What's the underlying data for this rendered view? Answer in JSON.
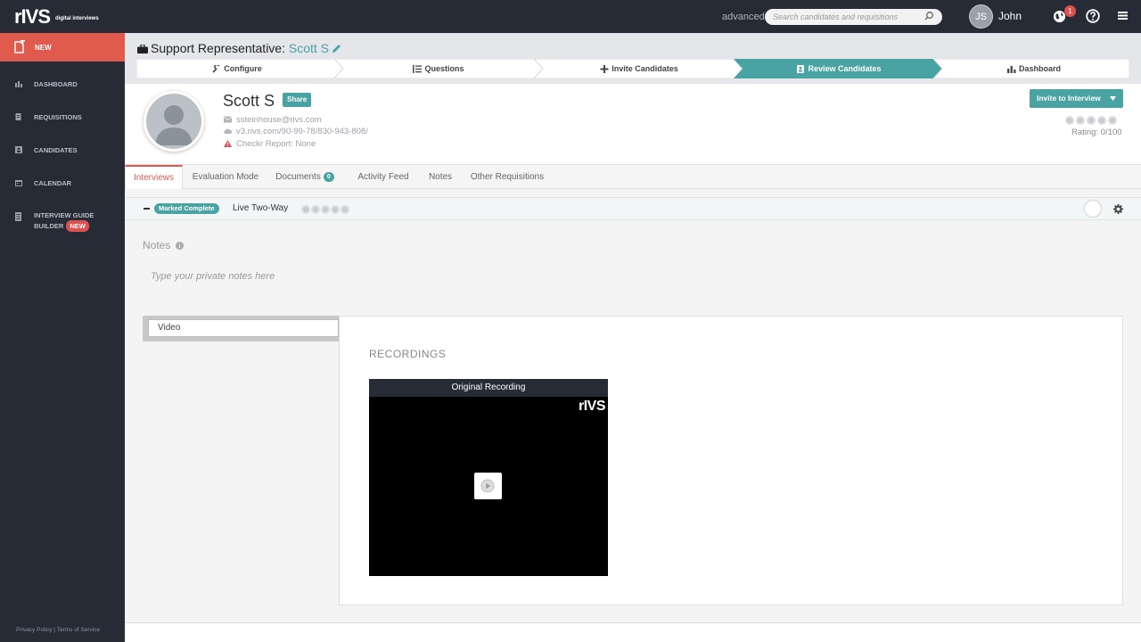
{
  "app": {
    "logo": "rIVS",
    "logo_sub": "digital interviews"
  },
  "topbar": {
    "advanced_label": "advanced",
    "search_placeholder": "Search candidates and requisitions",
    "avatar_initials": "JS",
    "username": "John",
    "notification_count": "1"
  },
  "sidebar": {
    "new_label": "NEW",
    "items": [
      {
        "label": "DASHBOARD",
        "icon": "bar-chart-icon"
      },
      {
        "label": "REQUISITIONS",
        "icon": "document-icon"
      },
      {
        "label": "CANDIDATES",
        "icon": "person-card-icon"
      },
      {
        "label": "CALENDAR",
        "icon": "calendar-icon"
      },
      {
        "label_line1": "INTERVIEW GUIDE",
        "label_line2": "BUILDER",
        "badge": "NEW",
        "icon": "guide-icon"
      }
    ],
    "footer": {
      "privacy": "Privacy Policy",
      "separator": "|",
      "terms": "Terms of Service"
    }
  },
  "header": {
    "requisition": "Support Representative:",
    "candidate": "Scott S",
    "steps": [
      {
        "label": "Configure",
        "icon": "wrench-icon"
      },
      {
        "label": "Questions",
        "icon": "list-icon"
      },
      {
        "label": "Invite Candidates",
        "icon": "plus-icon"
      },
      {
        "label": "Review Candidates",
        "icon": "person-card-icon",
        "active": true
      },
      {
        "label": "Dashboard",
        "icon": "bar-chart-icon"
      }
    ]
  },
  "profile": {
    "name": "Scott S",
    "share_label": "Share",
    "email": "ssteinhouse@rivs.com",
    "link": "v3.rivs.com/90-99-78/830-943-808/",
    "checkr": "Checkr Report: None",
    "invite_label": "Invite to Interview",
    "rating": "Rating: 0/100"
  },
  "tabs": [
    {
      "label": "Interviews",
      "active": true
    },
    {
      "label": "Evaluation Mode"
    },
    {
      "label": "Documents",
      "badge": "0"
    },
    {
      "label": "Activity Feed"
    },
    {
      "label": "Notes"
    },
    {
      "label": "Other Requisitions"
    }
  ],
  "interview": {
    "status": "Marked Complete",
    "type": "Live Two-Way"
  },
  "notes": {
    "label": "Notes",
    "placeholder": "Type your private notes here"
  },
  "media": {
    "select_value": "Video",
    "recordings_title": "RECORDINGS",
    "video_title": "Original Recording",
    "video_logo": "rIVS"
  },
  "colors": {
    "accent": "#4aa3a3",
    "brand_red": "#e05a4e",
    "dark": "#262b36"
  }
}
